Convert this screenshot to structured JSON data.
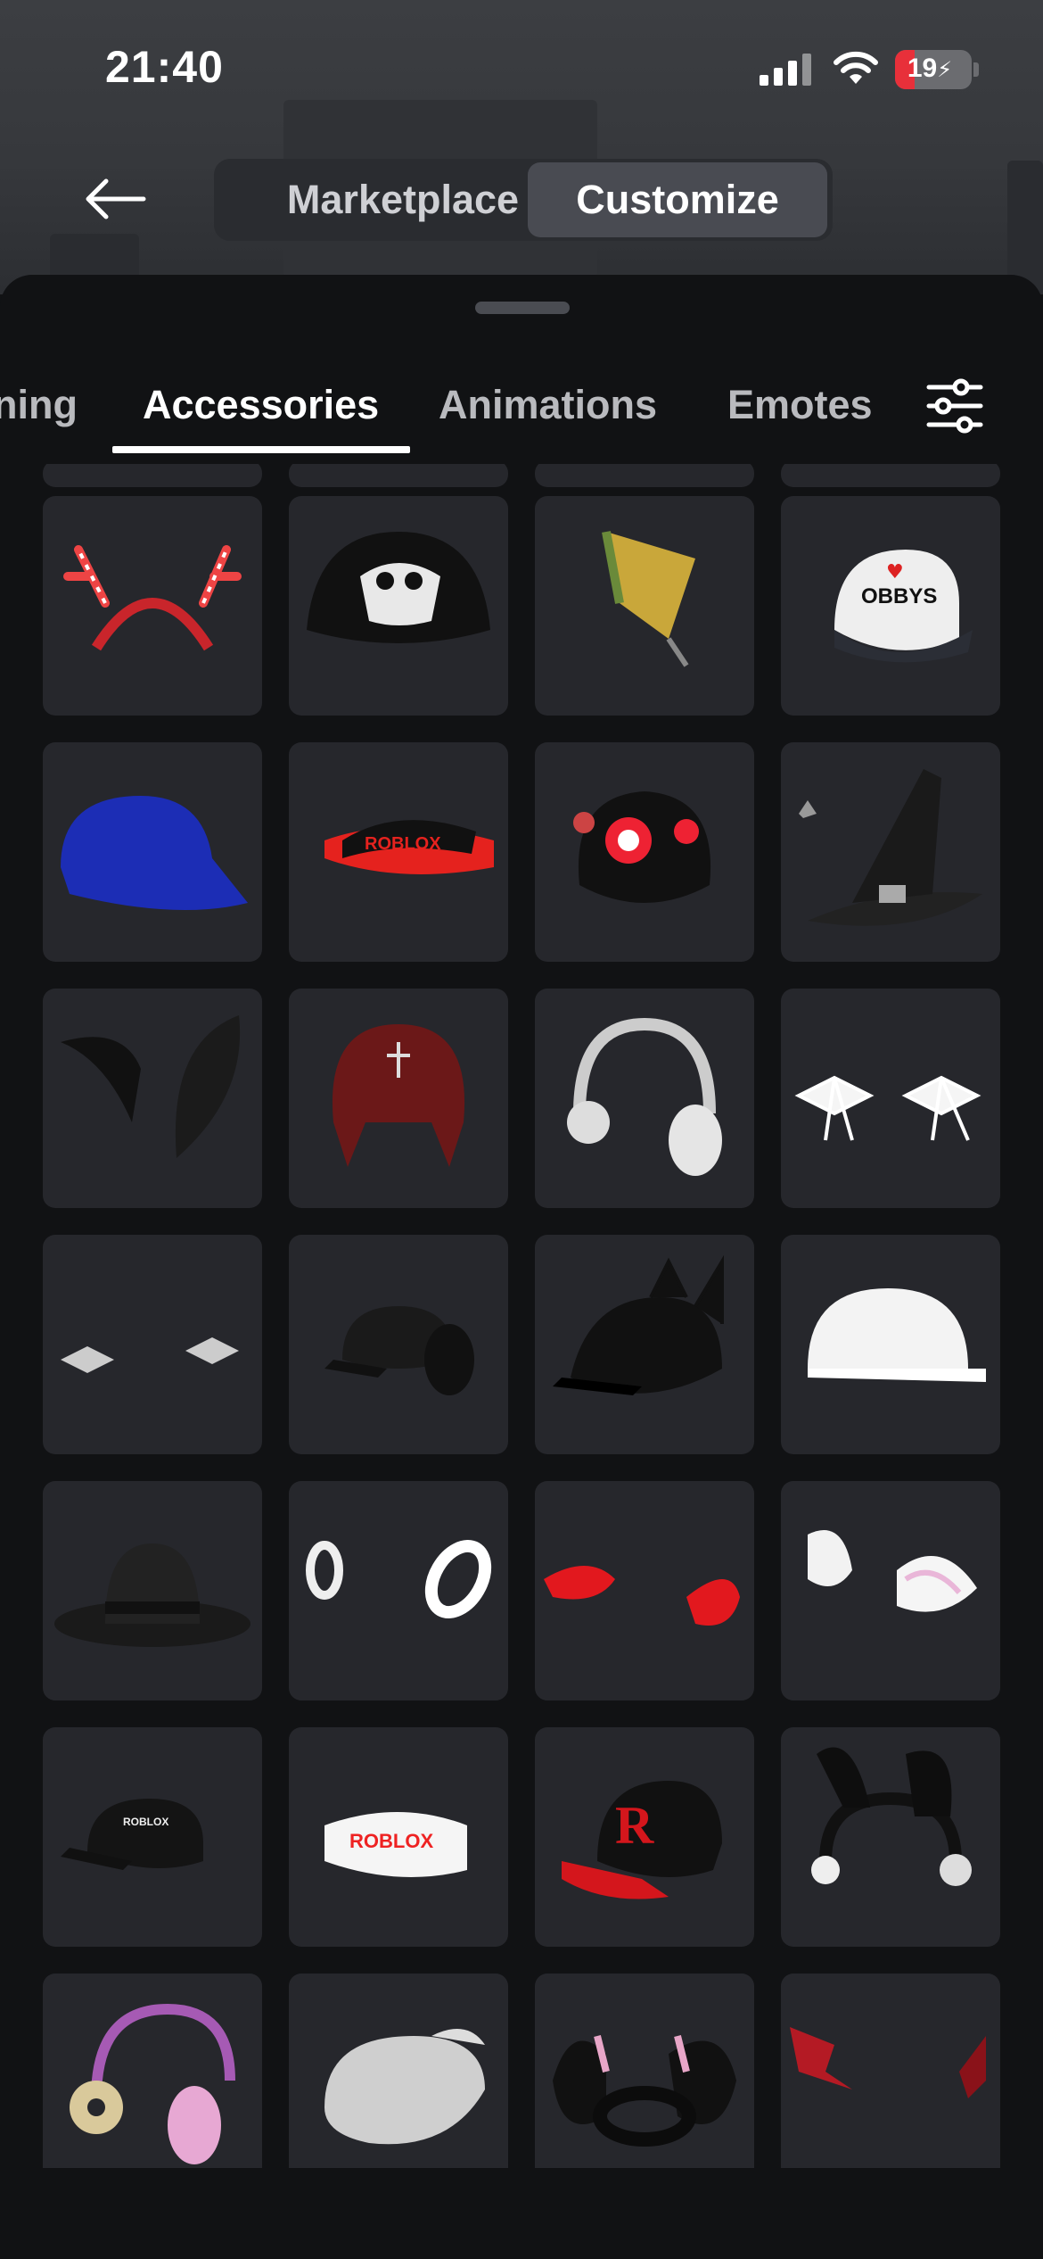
{
  "status_bar": {
    "time": "21:40",
    "battery_level": "19"
  },
  "header": {
    "segments": [
      "Marketplace",
      "Customize"
    ],
    "selected_segment": "Customize"
  },
  "tabs": {
    "items": [
      "ning",
      "Accessories",
      "Animations",
      "Emotes"
    ],
    "active": "Accessories"
  },
  "grid": {
    "columns": 4,
    "items": [
      {
        "icon": "reindeer-antler-headband-icon"
      },
      {
        "icon": "skull-beanie-icon"
      },
      {
        "icon": "yellow-flag-accessory-icon"
      },
      {
        "icon": "i-love-obbys-cap-icon"
      },
      {
        "icon": "blue-baseball-cap-icon"
      },
      {
        "icon": "roblox-visor-icon"
      },
      {
        "icon": "eyeball-bear-hat-icon"
      },
      {
        "icon": "witch-hat-icon"
      },
      {
        "icon": "black-horns-icon"
      },
      {
        "icon": "red-trapper-hat-icon"
      },
      {
        "icon": "white-headphones-icon"
      },
      {
        "icon": "white-bows-icon"
      },
      {
        "icon": "small-bows-icon"
      },
      {
        "icon": "black-puppy-ears-cap-icon"
      },
      {
        "icon": "cat-ears-cap-icon"
      },
      {
        "icon": "white-cap-icon"
      },
      {
        "icon": "black-fedora-icon"
      },
      {
        "icon": "white-hoops-icon"
      },
      {
        "icon": "red-horns-icon"
      },
      {
        "icon": "bunny-ears-icon"
      },
      {
        "icon": "black-roblox-cap-icon"
      },
      {
        "icon": "white-roblox-visor-icon"
      },
      {
        "icon": "red-r-cap-icon"
      },
      {
        "icon": "black-bunny-headband-icon"
      },
      {
        "icon": "donut-headphones-icon"
      },
      {
        "icon": "white-beret-icon"
      },
      {
        "icon": "black-bunny-ring-icon"
      },
      {
        "icon": "red-bat-wings-icon"
      }
    ]
  }
}
